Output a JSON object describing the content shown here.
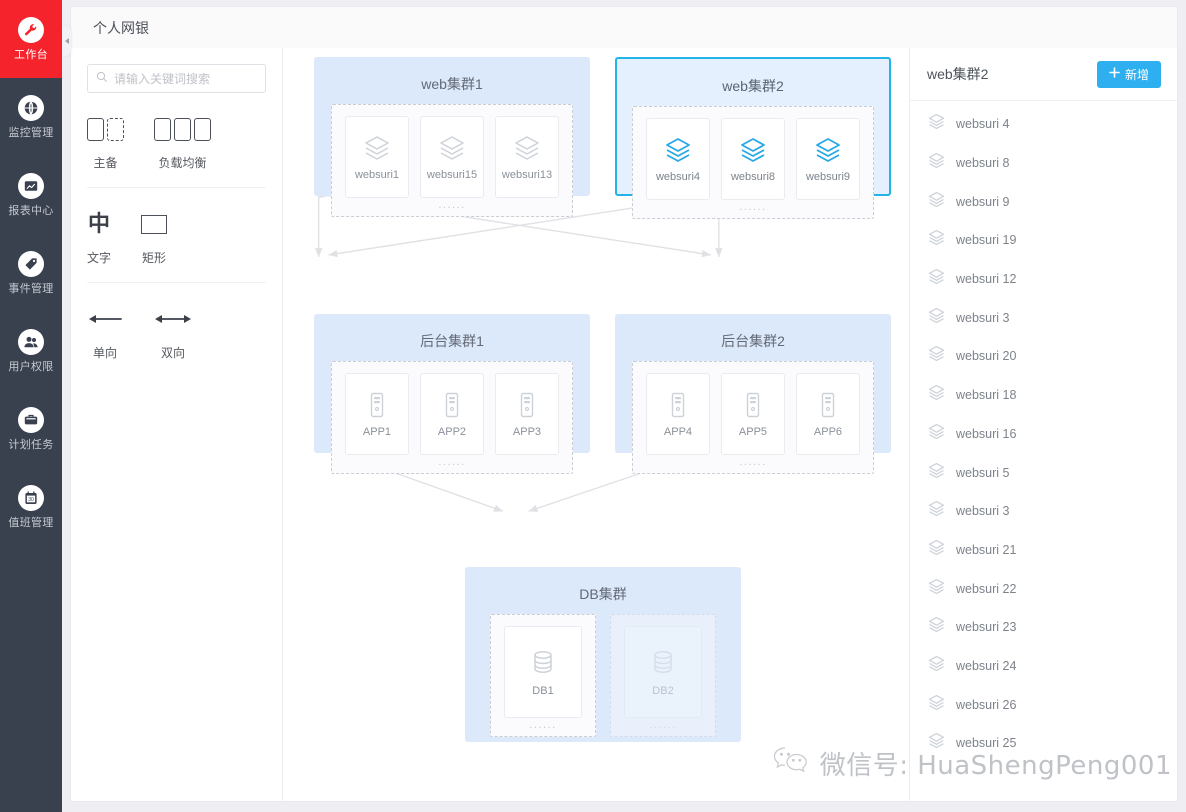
{
  "nav": {
    "items": [
      {
        "label": "工作台",
        "icon": "wrench-icon",
        "active": true
      },
      {
        "label": "监控管理",
        "icon": "monitor-globe-icon",
        "active": false
      },
      {
        "label": "报表中心",
        "icon": "report-chart-icon",
        "active": false
      },
      {
        "label": "事件管理",
        "icon": "tag-icon",
        "active": false
      },
      {
        "label": "用户权限",
        "icon": "users-icon",
        "active": false
      },
      {
        "label": "计划任务",
        "icon": "briefcase-icon",
        "active": false
      },
      {
        "label": "值班管理",
        "icon": "calendar-icon",
        "active": false
      }
    ],
    "active_color": "#f5232c",
    "background": "#39404e"
  },
  "topbar": {
    "title": "个人网银"
  },
  "tools": {
    "search": {
      "placeholder": "请输入关键词搜索",
      "value": ""
    },
    "groups": [
      {
        "items": [
          {
            "label": "主备",
            "icon": "active-standby-icon"
          },
          {
            "label": "负载均衡",
            "icon": "load-balance-icon"
          }
        ]
      },
      {
        "items": [
          {
            "label": "文字",
            "icon": "text-icon",
            "glyph": "中"
          },
          {
            "label": "矩形",
            "icon": "rectangle-icon"
          }
        ]
      },
      {
        "items": [
          {
            "label": "单向",
            "icon": "arrow-one-way-icon"
          },
          {
            "label": "双向",
            "icon": "arrow-two-way-icon"
          }
        ]
      }
    ]
  },
  "canvas": {
    "clusters": [
      {
        "id": "web1",
        "title": "web集群1",
        "selected": false,
        "accent": "#b9c4d2",
        "nodes": [
          {
            "label": "websuri1",
            "icon": "layers-icon"
          },
          {
            "label": "websuri15",
            "icon": "layers-icon"
          },
          {
            "label": "websuri13",
            "icon": "layers-icon"
          }
        ],
        "more": "......"
      },
      {
        "id": "web2",
        "title": "web集群2",
        "selected": true,
        "accent": "#22b3e8",
        "nodes": [
          {
            "label": "websuri4",
            "icon": "layers-icon"
          },
          {
            "label": "websuri8",
            "icon": "layers-icon"
          },
          {
            "label": "websuri9",
            "icon": "layers-icon"
          }
        ],
        "more": "......"
      },
      {
        "id": "app1",
        "title": "后台集群1",
        "selected": false,
        "accent": "#b9c4d2",
        "nodes": [
          {
            "label": "APP1",
            "icon": "server-icon"
          },
          {
            "label": "APP2",
            "icon": "server-icon"
          },
          {
            "label": "APP3",
            "icon": "server-icon"
          }
        ],
        "more": "......"
      },
      {
        "id": "app2",
        "title": "后台集群2",
        "selected": false,
        "accent": "#b9c4d2",
        "nodes": [
          {
            "label": "APP4",
            "icon": "server-icon"
          },
          {
            "label": "APP5",
            "icon": "server-icon"
          },
          {
            "label": "APP6",
            "icon": "server-icon"
          }
        ],
        "more": "......"
      }
    ],
    "db_cluster": {
      "id": "db",
      "title": "DB集群",
      "primary": {
        "label": "DB1",
        "icon": "database-icon",
        "more": "......"
      },
      "standby": {
        "label": "DB2",
        "icon": "database-icon",
        "more": "......"
      }
    },
    "connections": [
      {
        "from": "web1",
        "to": "app1",
        "type": "two-way"
      },
      {
        "from": "web1",
        "to": "app2",
        "type": "two-way"
      },
      {
        "from": "web2",
        "to": "app1",
        "type": "two-way"
      },
      {
        "from": "web2",
        "to": "app2",
        "type": "two-way"
      },
      {
        "from": "app1",
        "to": "db",
        "type": "two-way"
      },
      {
        "from": "app2",
        "to": "db",
        "type": "two-way"
      }
    ]
  },
  "rightpanel": {
    "title": "web集群2",
    "add_label": "新增",
    "add_icon": "plus-icon",
    "accent": "#2eb0f0",
    "items": [
      {
        "label": "websuri 4",
        "icon": "layers-icon"
      },
      {
        "label": "websuri 8",
        "icon": "layers-icon"
      },
      {
        "label": "websuri 9",
        "icon": "layers-icon"
      },
      {
        "label": "websuri 19",
        "icon": "layers-icon"
      },
      {
        "label": "websuri 12",
        "icon": "layers-icon"
      },
      {
        "label": "websuri 3",
        "icon": "layers-icon"
      },
      {
        "label": "websuri 20",
        "icon": "layers-icon"
      },
      {
        "label": "websuri 18",
        "icon": "layers-icon"
      },
      {
        "label": "websuri 16",
        "icon": "layers-icon"
      },
      {
        "label": "websuri 5",
        "icon": "layers-icon"
      },
      {
        "label": "websuri 3",
        "icon": "layers-icon"
      },
      {
        "label": "websuri 21",
        "icon": "layers-icon"
      },
      {
        "label": "websuri 22",
        "icon": "layers-icon"
      },
      {
        "label": "websuri 23",
        "icon": "layers-icon"
      },
      {
        "label": "websuri 24",
        "icon": "layers-icon"
      },
      {
        "label": "websuri 26",
        "icon": "layers-icon"
      },
      {
        "label": "websuri 25",
        "icon": "layers-icon"
      }
    ]
  },
  "watermark": {
    "text": "微信号: HuaShengPeng001",
    "icon": "wechat-icon"
  }
}
